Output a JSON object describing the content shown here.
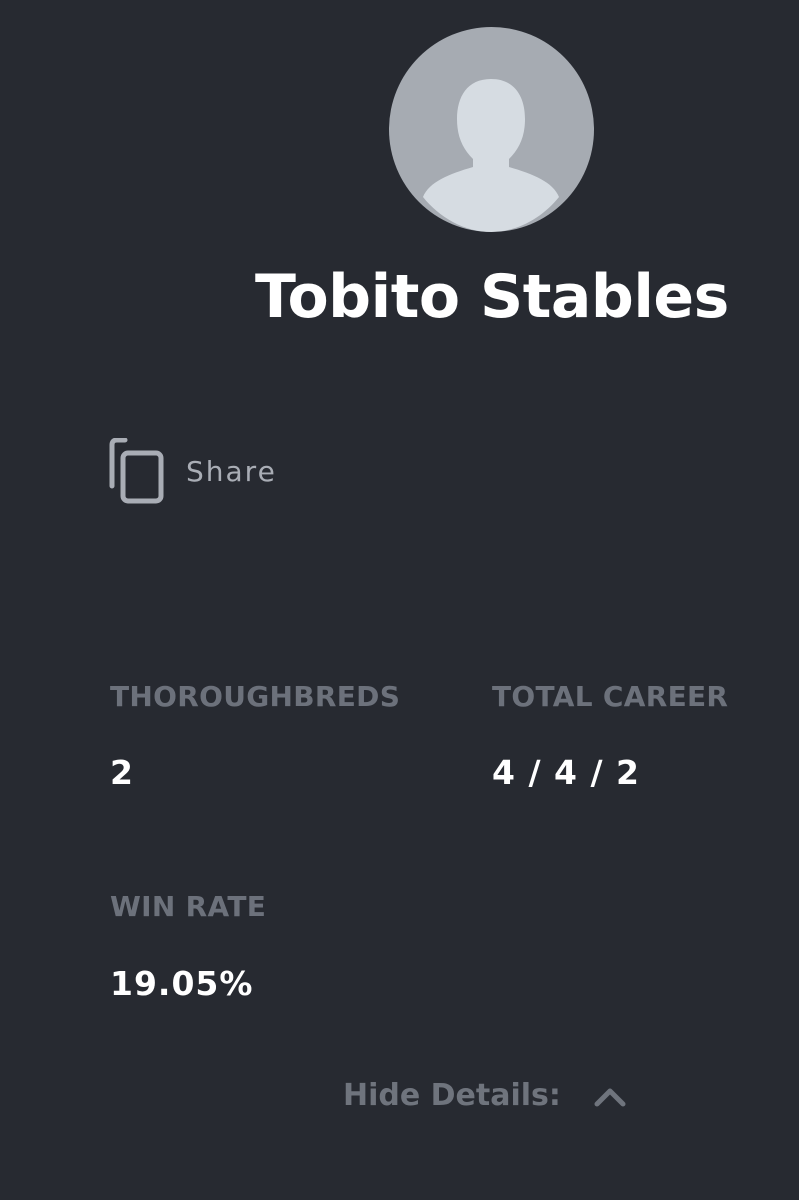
{
  "profile": {
    "name": "Tobito Stables",
    "avatar_icon": "default-user-avatar-icon"
  },
  "share": {
    "label": "Share",
    "icon": "copy-icon"
  },
  "stats": {
    "thoroughbreds": {
      "label": "THOROUGHBREDS",
      "value": "2"
    },
    "total_career": {
      "label": "TOTAL CAREER",
      "value": "4 / 4 / 2"
    },
    "win_rate": {
      "label": "WIN RATE",
      "value": "19.05%"
    }
  },
  "details_toggle": {
    "label": "Hide Details:",
    "icon": "chevron-up-icon"
  },
  "colors": {
    "background": "#272a31",
    "avatar_bg": "#a6abb2",
    "avatar_silhouette": "#d6dce2",
    "heading": "#ffffff",
    "muted_label": "#6c717b",
    "share_text": "#a9adb5"
  }
}
